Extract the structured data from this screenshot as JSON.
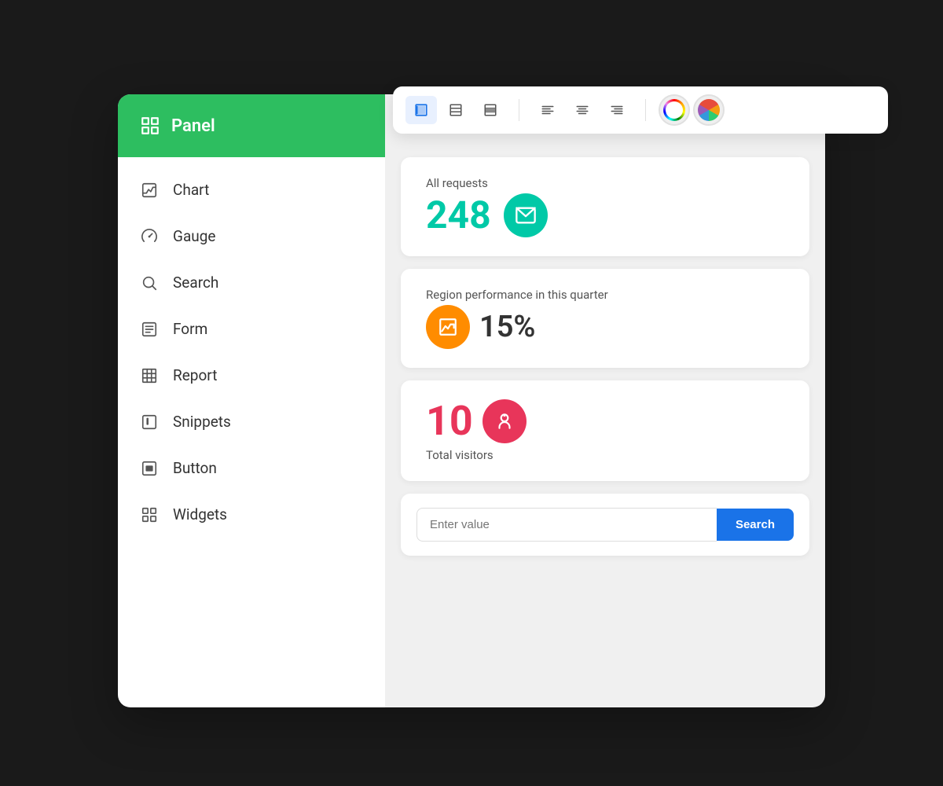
{
  "sidebar": {
    "header": {
      "title": "Panel",
      "icon": "panel-icon"
    },
    "items": [
      {
        "id": "chart",
        "label": "Chart",
        "icon": "chart-icon"
      },
      {
        "id": "gauge",
        "label": "Gauge",
        "icon": "gauge-icon"
      },
      {
        "id": "search",
        "label": "Search",
        "icon": "search-icon"
      },
      {
        "id": "form",
        "label": "Form",
        "icon": "form-icon"
      },
      {
        "id": "report",
        "label": "Report",
        "icon": "report-icon"
      },
      {
        "id": "snippets",
        "label": "Snippets",
        "icon": "snippets-icon"
      },
      {
        "id": "button",
        "label": "Button",
        "icon": "button-icon"
      },
      {
        "id": "widgets",
        "label": "Widgets",
        "icon": "widgets-icon"
      }
    ]
  },
  "toolbar": {
    "buttons": [
      {
        "id": "align-left-layout",
        "active": true
      },
      {
        "id": "align-center-layout",
        "active": false
      },
      {
        "id": "align-right-layout",
        "active": false
      },
      {
        "id": "text-left",
        "active": false
      },
      {
        "id": "text-center",
        "active": false
      },
      {
        "id": "text-right",
        "active": false
      }
    ]
  },
  "cards": {
    "requests": {
      "label": "All requests",
      "value": "248",
      "icon_type": "email"
    },
    "region": {
      "label": "Region performance in this quarter",
      "value": "15%",
      "icon_type": "chart-up"
    },
    "visitors": {
      "value": "10",
      "label": "Total visitors",
      "icon_type": "user-star"
    },
    "search": {
      "placeholder": "Enter value",
      "button_label": "Search"
    }
  },
  "colors": {
    "sidebar_header_bg": "#2dbe60",
    "teal": "#00c9a7",
    "orange": "#ff8c00",
    "red": "#e8355a",
    "blue": "#1a73e8"
  }
}
